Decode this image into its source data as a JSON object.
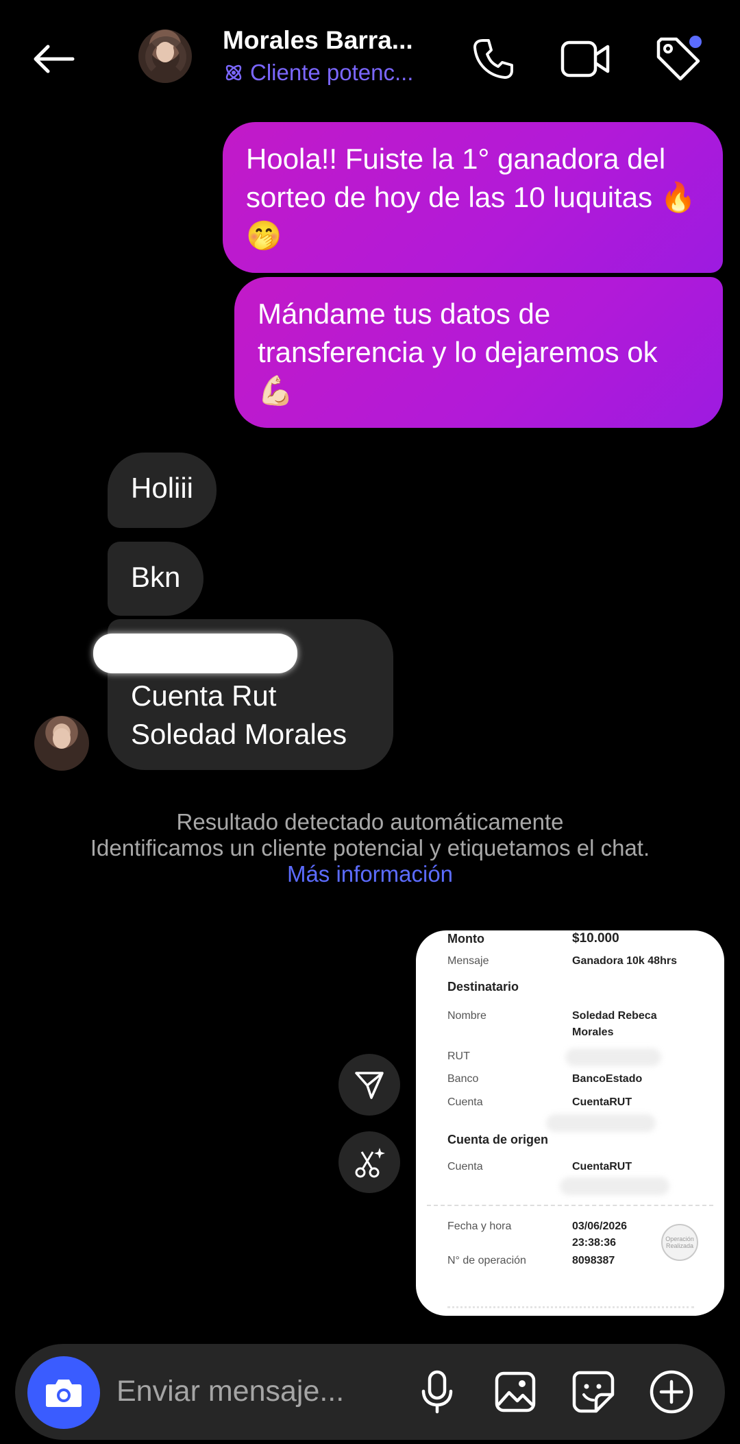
{
  "header": {
    "contact_name": "Morales Barra...",
    "contact_label": "Cliente potenc...",
    "accent_color": "#7b67ff",
    "icons": [
      "back-arrow-icon",
      "phone-icon",
      "video-camera-icon",
      "tag-icon"
    ]
  },
  "messages": {
    "out_1": "Hoola!! Fuiste la 1° ganadora del sorteo de hoy de las 10 luquitas 🔥🤭",
    "out_2": "Mándame tus datos de transferencia y lo dejaremos ok 💪🏻",
    "in_1": "Holiii",
    "in_2": "Bkn",
    "in_3_line1": "Cuenta Rut",
    "in_3_line2": "Soledad Morales"
  },
  "system_note": {
    "line1": "Resultado detectado automáticamente",
    "line2": "Identificamos un cliente potencial y etiquetamos el chat.",
    "link": "Más información"
  },
  "receipt": {
    "monto_label": "Monto",
    "monto_value": "$10.000",
    "mensaje_label": "Mensaje",
    "mensaje_value": "Ganadora 10k 48hrs",
    "destinatario_title": "Destinatario",
    "nombre_label": "Nombre",
    "nombre_value_1": "Soledad Rebeca",
    "nombre_value_2": "Morales",
    "rut_label": "RUT",
    "banco_label": "Banco",
    "banco_value": "BancoEstado",
    "cuenta_label": "Cuenta",
    "cuenta_value": "CuentaRUT",
    "origen_title": "Cuenta de origen",
    "origen_cuenta_label": "Cuenta",
    "origen_cuenta_value": "CuentaRUT",
    "fecha_label": "Fecha y hora",
    "fecha_value": "03/06/2026",
    "hora_value": "23:38:36",
    "operacion_label": "N° de operación",
    "operacion_value": "8098387",
    "stamp_text": "Operación Realizada"
  },
  "composer": {
    "placeholder": "Enviar mensaje...",
    "camera_color": "#3a5cff"
  }
}
